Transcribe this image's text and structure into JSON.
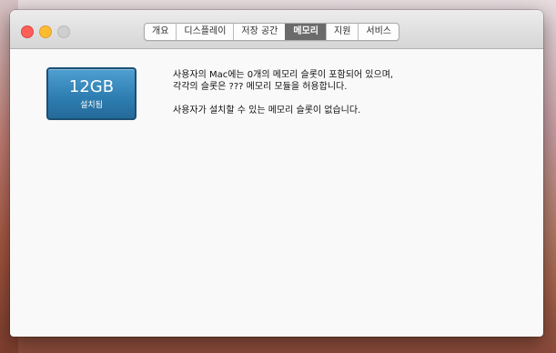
{
  "window": {
    "tabs": [
      {
        "label": "개요"
      },
      {
        "label": "디스플레이"
      },
      {
        "label": "저장 공간"
      },
      {
        "label": "메모리",
        "active": true
      },
      {
        "label": "지원"
      },
      {
        "label": "서비스"
      }
    ]
  },
  "memory": {
    "installed_size": "12GB",
    "installed_label": "설치됨",
    "description_line1": "사용자의 Mac에는 0개의 메모리 슬롯이 포함되어 있으며,",
    "description_line2": "각각의 슬롯은 ??? 메모리 모듈을 허용합니다.",
    "upgrade_note": "사용자가 설치할 수 있는 메모리 슬롯이 없습니다."
  },
  "colors": {
    "close": "#fc5f57",
    "minimize": "#fdbc2e",
    "zoom_disabled": "#cfcfcf",
    "active_tab": "#6b6b6b",
    "badge": "#2f7fb3"
  }
}
